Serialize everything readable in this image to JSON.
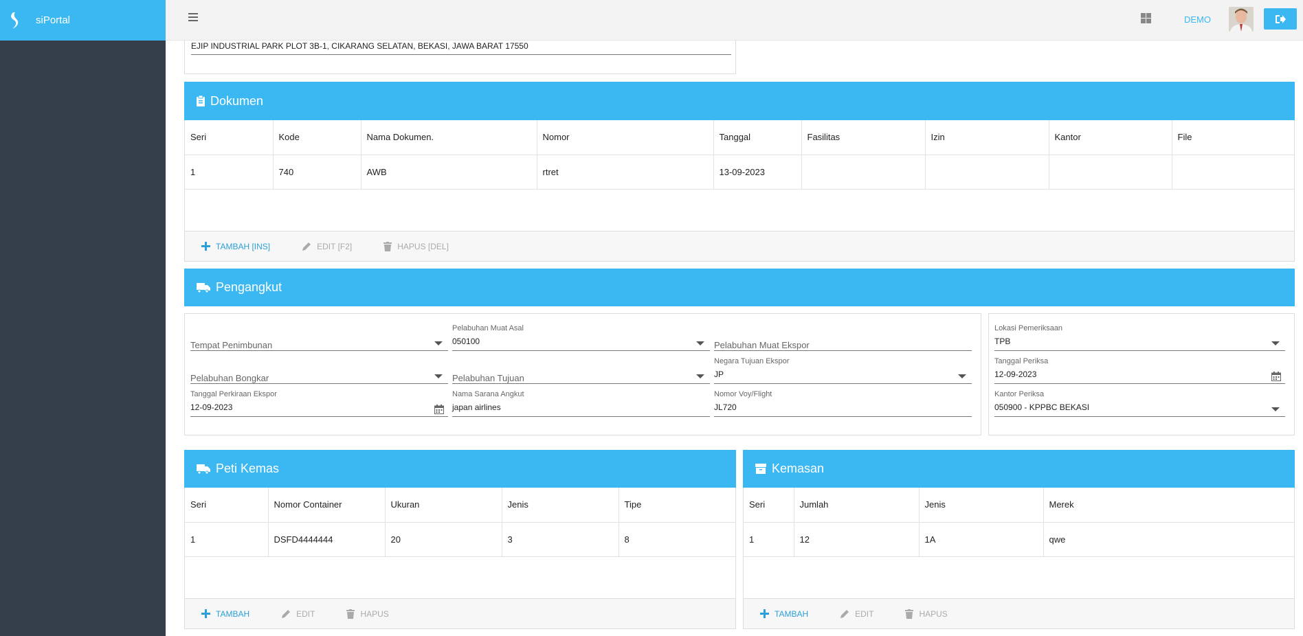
{
  "app": {
    "name": "siPortal",
    "user_label": "DEMO"
  },
  "address": {
    "value": "EJIP INDUSTRIAL PARK PLOT 3B-1, CIKARANG SELATAN, BEKASI, JAWA BARAT 17550"
  },
  "dokumen": {
    "title": "Dokumen",
    "columns": [
      "Seri",
      "Kode",
      "Nama Dokumen.",
      "Nomor",
      "Tanggal",
      "Fasilitas",
      "Izin",
      "Kantor",
      "File"
    ],
    "rows": [
      [
        "1",
        "740",
        "AWB",
        "rtret",
        "13-09-2023",
        "",
        "",
        "",
        ""
      ]
    ],
    "actions": {
      "add": "TAMBAH [INS]",
      "edit": "EDIT [F2]",
      "delete": "HAPUS [DEL]"
    }
  },
  "pengangkut": {
    "title": "Pengangkut",
    "fields": {
      "tempat_penimbunan": {
        "label": "Tempat Penimbunan",
        "value": ""
      },
      "pelabuhan_muat_asal": {
        "label": "Pelabuhan Muat Asal",
        "value": "050100"
      },
      "pelabuhan_muat_ekspor": {
        "label": "Pelabuhan Muat Ekspor",
        "value": ""
      },
      "pelabuhan_bongkar": {
        "label": "Pelabuhan Bongkar",
        "value": ""
      },
      "pelabuhan_tujuan": {
        "label": "Pelabuhan Tujuan",
        "value": ""
      },
      "negara_tujuan_ekspor": {
        "label": "Negara Tujuan Ekspor",
        "value": "JP"
      },
      "tanggal_perkiraan_ekspor": {
        "label": "Tanggal Perkiraan Ekspor",
        "value": "12-09-2023"
      },
      "nama_sarana_angkut": {
        "label": "Nama Sarana Angkut",
        "value": "japan airlines"
      },
      "nomor_voy_flight": {
        "label": "Nomor Voy/Flight",
        "value": "JL720"
      },
      "lokasi_pemeriksaan": {
        "label": "Lokasi Pemeriksaan",
        "value": "TPB"
      },
      "tanggal_periksa": {
        "label": "Tanggal Periksa",
        "value": "12-09-2023"
      },
      "kantor_periksa": {
        "label": "Kantor Periksa",
        "value": "050900 - KPPBC BEKASI"
      }
    }
  },
  "peti_kemas": {
    "title": "Peti Kemas",
    "columns": [
      "Seri",
      "Nomor Container",
      "Ukuran",
      "Jenis",
      "Tipe"
    ],
    "rows": [
      [
        "1",
        "DSFD4444444",
        "20",
        "3",
        "8"
      ]
    ],
    "actions": {
      "add": "TAMBAH",
      "edit": "EDIT",
      "delete": "HAPUS"
    }
  },
  "kemasan": {
    "title": "Kemasan",
    "columns": [
      "Seri",
      "Jumlah",
      "Jenis",
      "Merek"
    ],
    "rows": [
      [
        "1",
        "12",
        "1A",
        "qwe"
      ]
    ],
    "actions": {
      "add": "TAMBAH",
      "edit": "EDIT",
      "delete": "HAPUS"
    }
  },
  "colors": {
    "accent": "#3bb8f2",
    "sidebar": "#353f4b"
  },
  "icons": {
    "brand": "siportal-logo",
    "menu": "hamburger-icon",
    "apps": "grid-icon",
    "logout": "sign-out-icon"
  }
}
